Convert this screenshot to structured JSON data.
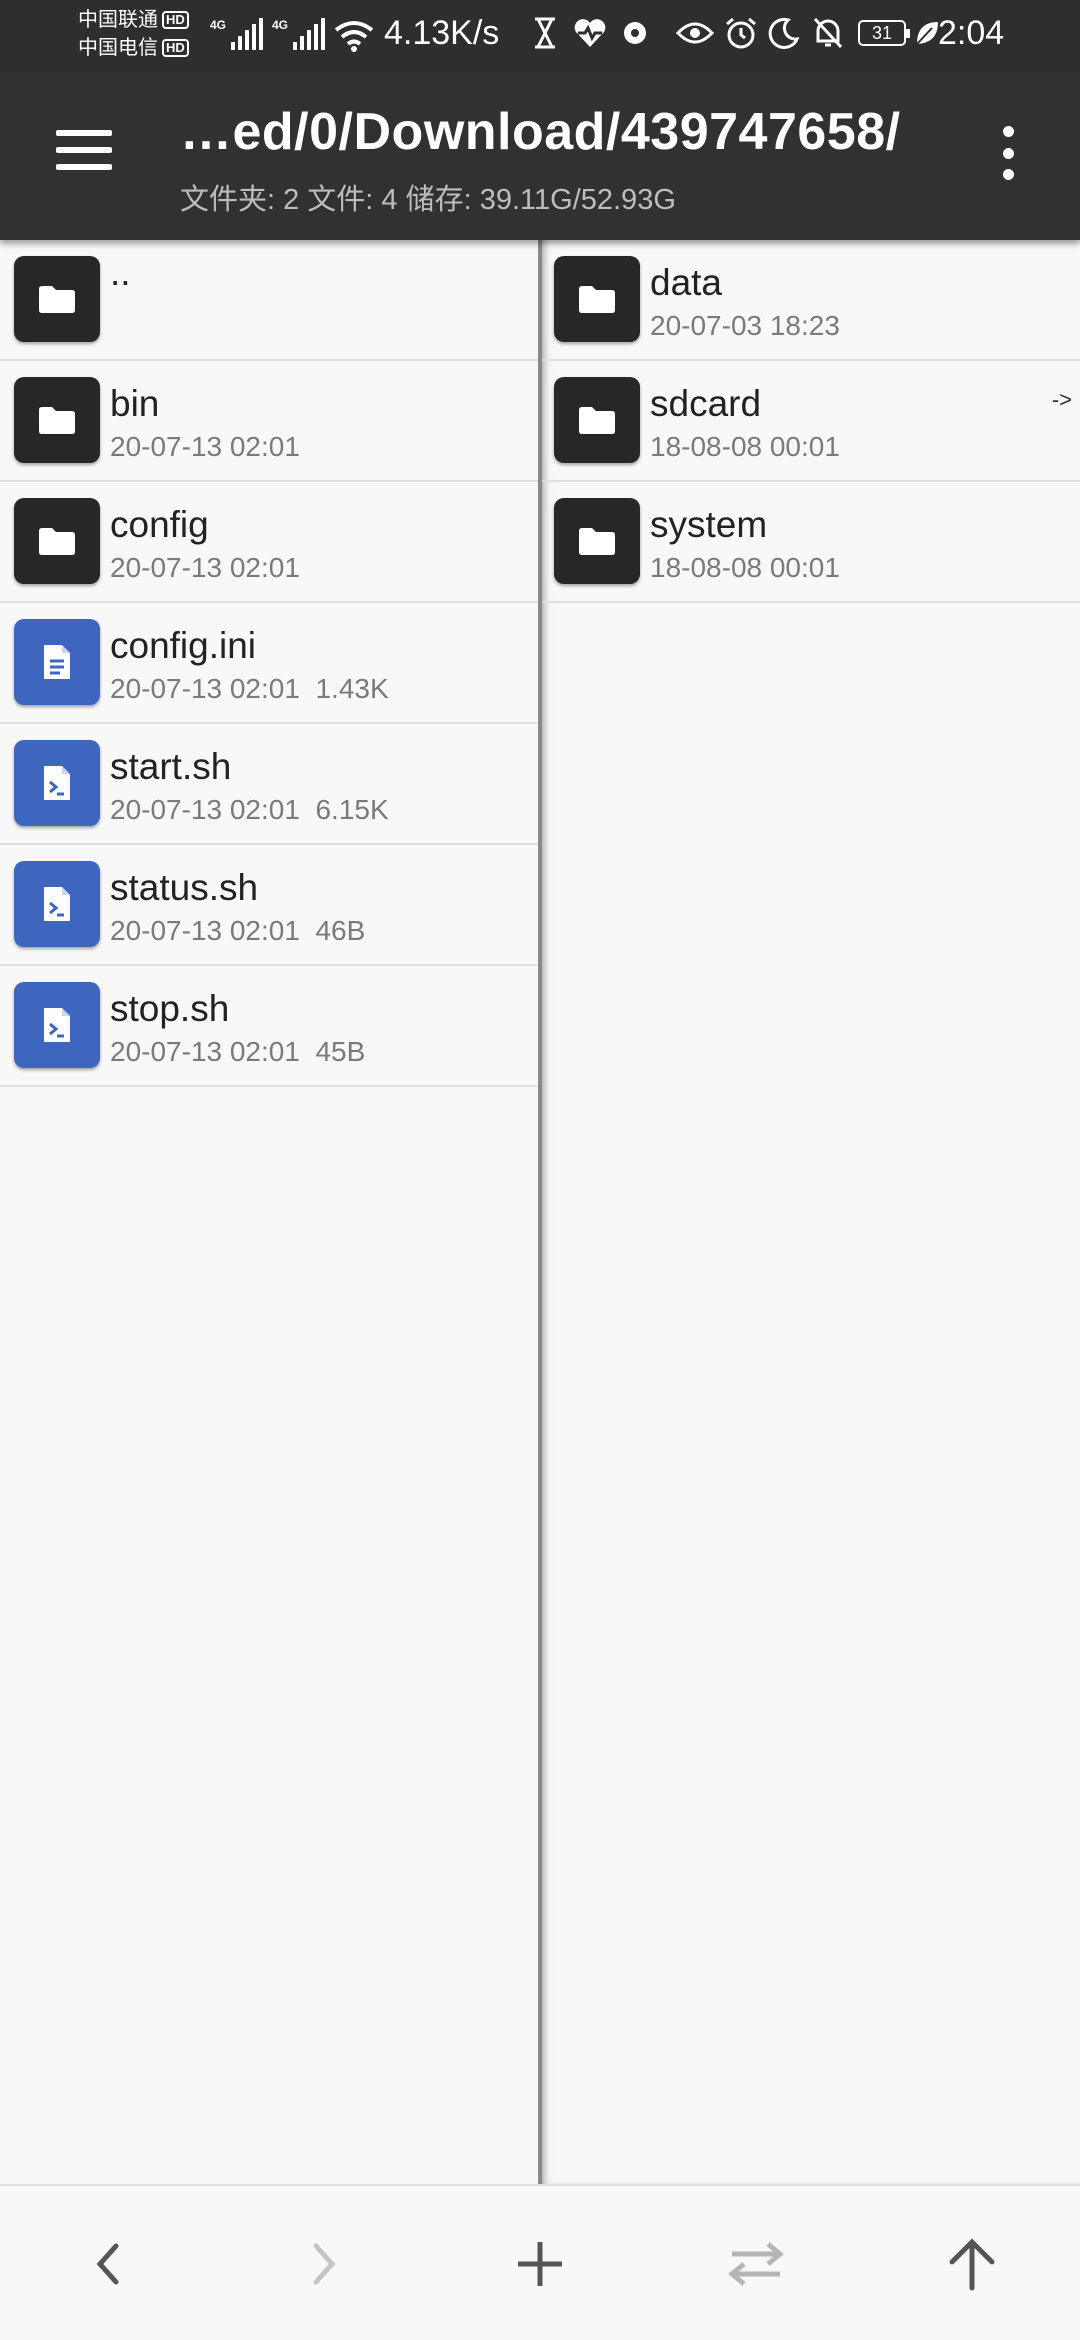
{
  "status_bar": {
    "carrier1": "中国联通",
    "carrier2": "中国电信",
    "hd_badge": "HD",
    "network_type": "4G",
    "net_speed": "4.13K/s",
    "battery_level": "31",
    "time": "2:04",
    "icons": [
      "hourglass-icon",
      "heart-rate-icon",
      "record-icon",
      "eye-icon",
      "alarm-icon",
      "moon-icon",
      "bell-off-icon",
      "battery-icon",
      "leaf-icon"
    ]
  },
  "appbar": {
    "path": "…ed/0/Download/439747658/",
    "summary": "文件夹: 2  文件: 4  储存: 39.11G/52.93G"
  },
  "left_pane": {
    "items": [
      {
        "name": "..",
        "meta": "",
        "icon": "folder-icon",
        "kind": "folder"
      },
      {
        "name": "bin",
        "meta": "20-07-13 02:01",
        "icon": "folder-icon",
        "kind": "folder"
      },
      {
        "name": "config",
        "meta": "20-07-13 02:01",
        "icon": "folder-icon",
        "kind": "folder"
      },
      {
        "name": "config.ini",
        "meta": "20-07-13 02:01  1.43K",
        "icon": "text-file-icon",
        "kind": "text"
      },
      {
        "name": "start.sh",
        "meta": "20-07-13 02:01  6.15K",
        "icon": "script-file-icon",
        "kind": "script"
      },
      {
        "name": "status.sh",
        "meta": "20-07-13 02:01  46B",
        "icon": "script-file-icon",
        "kind": "script"
      },
      {
        "name": "stop.sh",
        "meta": "20-07-13 02:01  45B",
        "icon": "script-file-icon",
        "kind": "script"
      }
    ]
  },
  "right_pane": {
    "items": [
      {
        "name": "data",
        "meta": "20-07-03 18:23",
        "icon": "folder-icon",
        "kind": "folder"
      },
      {
        "name": "sdcard",
        "meta": "18-08-08 00:01",
        "icon": "folder-icon",
        "kind": "folder",
        "link": "->"
      },
      {
        "name": "system",
        "meta": "18-08-08 00:01",
        "icon": "folder-icon",
        "kind": "folder"
      }
    ]
  },
  "bottom_bar": {
    "buttons": [
      "back-icon",
      "forward-icon",
      "add-icon",
      "swap-icon",
      "up-icon"
    ]
  },
  "colors": {
    "appbar": "#313131",
    "statusbar": "#2e2e2e",
    "folder_tile": "#272727",
    "file_tile": "#3f66bf",
    "background": "#f8f8f8"
  }
}
